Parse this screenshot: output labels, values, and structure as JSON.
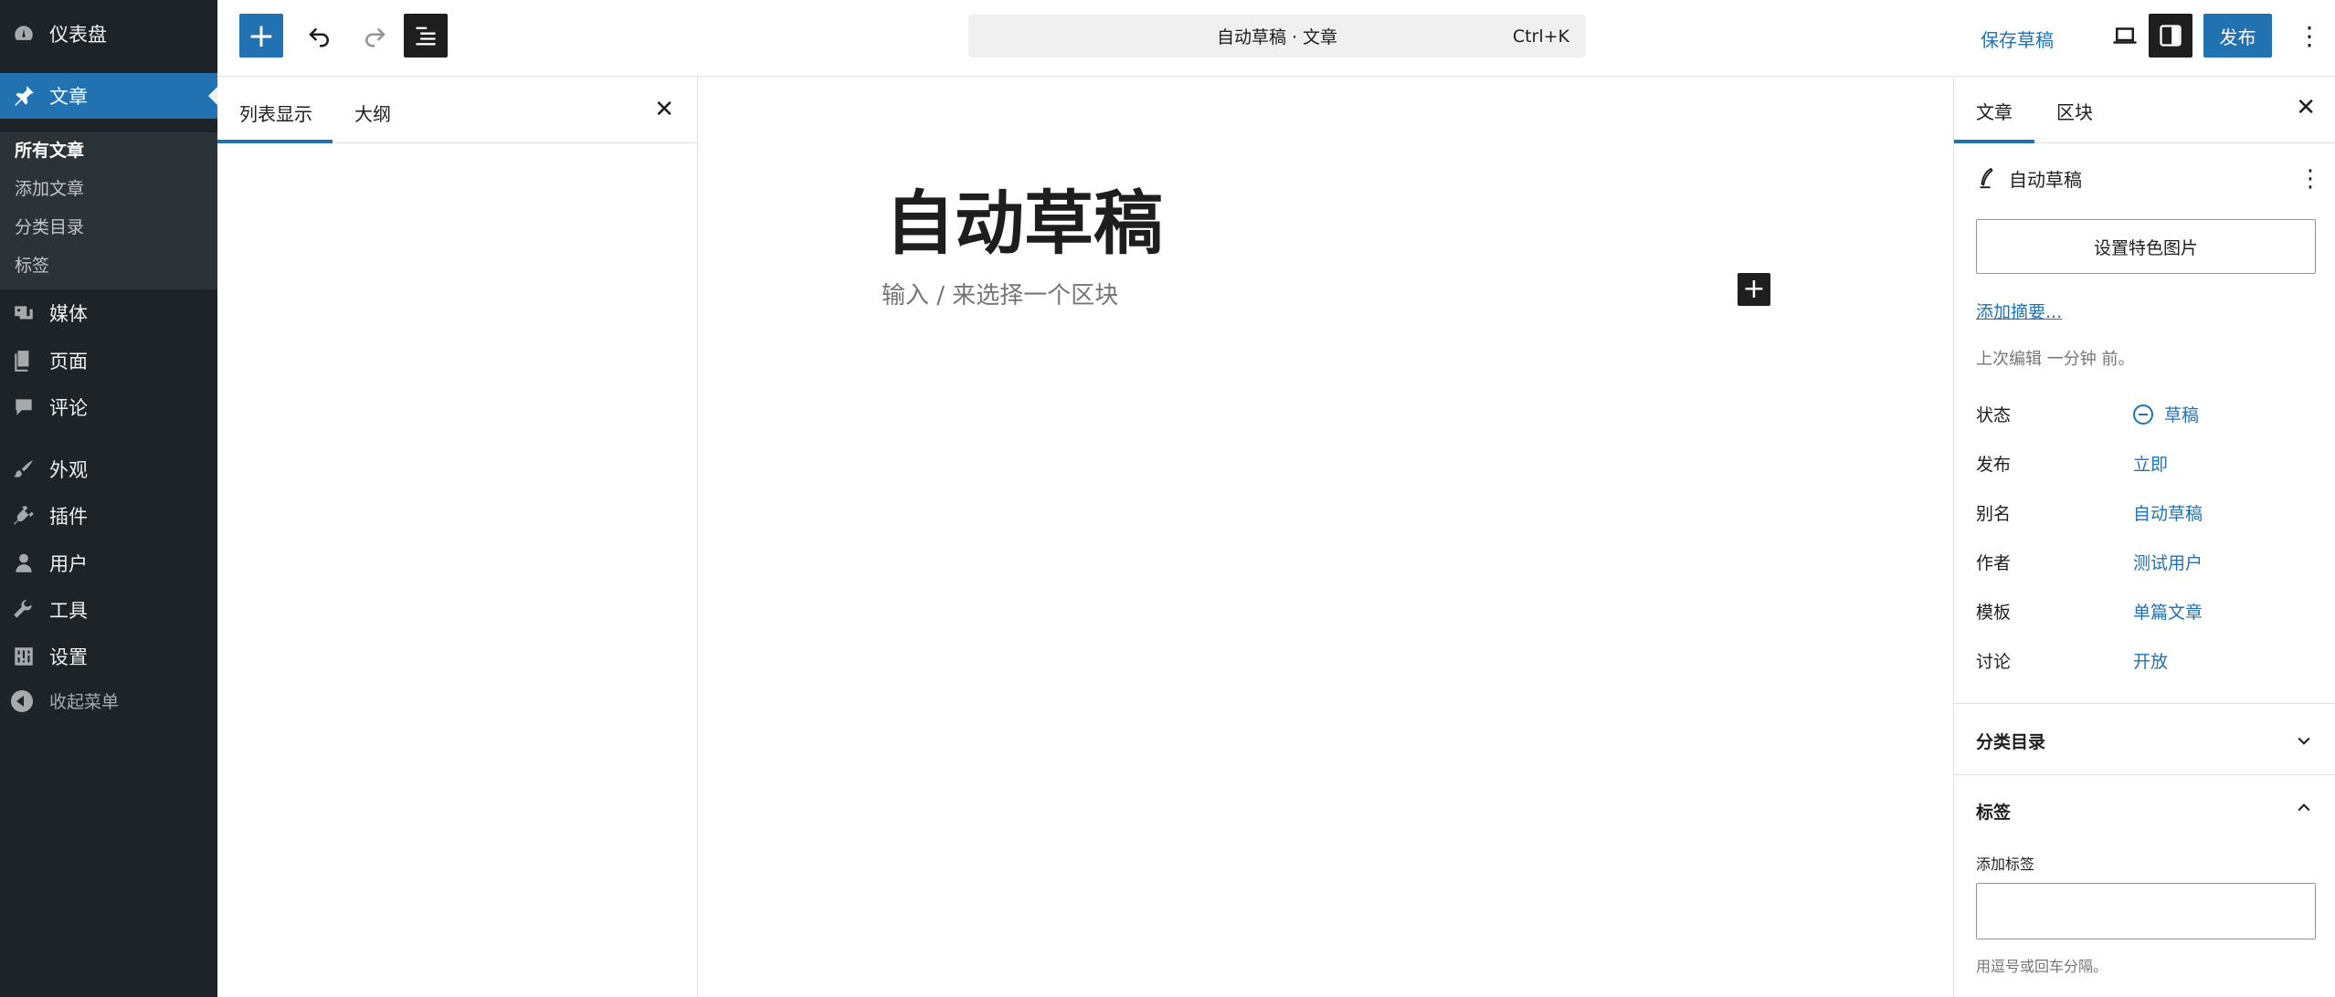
{
  "admin_menu": {
    "items": [
      {
        "label": "仪表盘",
        "icon": "dashboard-icon"
      },
      {
        "label": "文章",
        "icon": "pin-icon",
        "current": true
      },
      {
        "label": "媒体",
        "icon": "media-icon"
      },
      {
        "label": "页面",
        "icon": "page-icon"
      },
      {
        "label": "评论",
        "icon": "comment-icon"
      },
      {
        "label": "外观",
        "icon": "appearance-icon"
      },
      {
        "label": "插件",
        "icon": "plugin-icon"
      },
      {
        "label": "用户",
        "icon": "user-icon"
      },
      {
        "label": "工具",
        "icon": "wrench-icon"
      },
      {
        "label": "设置",
        "icon": "settings-icon"
      }
    ],
    "submenu": [
      "所有文章",
      "添加文章",
      "分类目录",
      "标签"
    ],
    "collapse_label": "收起菜单"
  },
  "topbar": {
    "command_title": "自动草稿 · 文章",
    "command_shortcut": "Ctrl+K",
    "save_draft": "保存草稿",
    "publish": "发布"
  },
  "listview": {
    "tab_list": "列表显示",
    "tab_outline": "大纲"
  },
  "canvas": {
    "title": "自动草稿",
    "placeholder": "输入 / 来选择一个区块"
  },
  "settings": {
    "tab_post": "文章",
    "tab_block": "区块",
    "doc_title": "自动草稿",
    "featured_image": "设置特色图片",
    "add_excerpt": "添加摘要...",
    "last_edited": "上次编辑 一分钟 前。",
    "props": [
      {
        "label": "状态",
        "value": "草稿"
      },
      {
        "label": "发布",
        "value": "立即"
      },
      {
        "label": "别名",
        "value": "自动草稿"
      },
      {
        "label": "作者",
        "value": "测试用户"
      },
      {
        "label": "模板",
        "value": "单篇文章"
      },
      {
        "label": "讨论",
        "value": "开放"
      }
    ],
    "categories_panel": "分类目录",
    "tags_panel": "标签",
    "add_tag_label": "添加标签",
    "tag_help": "用逗号或回车分隔。"
  },
  "colors": {
    "accent": "#2271b1",
    "admin_bg": "#1d2327",
    "submenu_bg": "#2c3338"
  }
}
